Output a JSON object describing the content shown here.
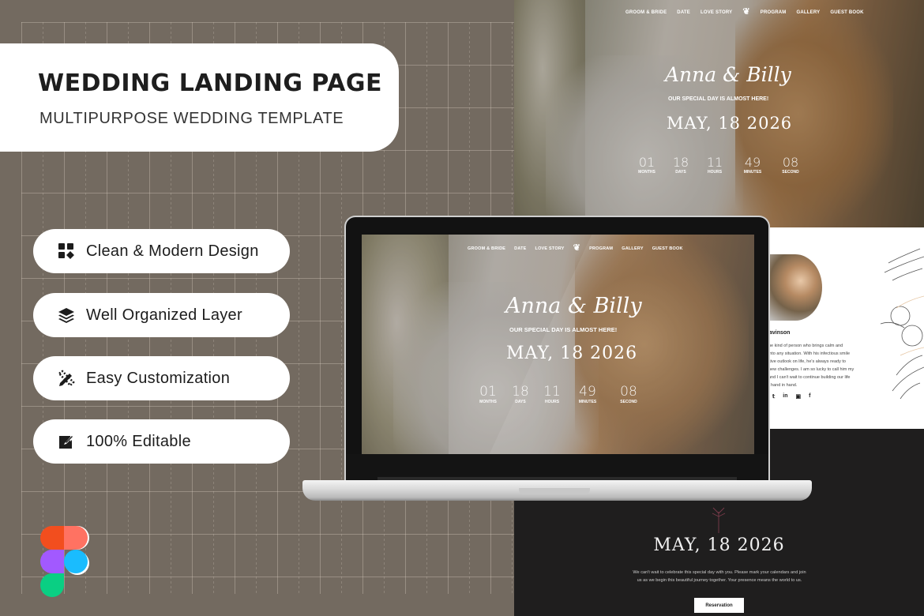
{
  "banner": {
    "title": "WEDDING LANDING PAGE",
    "subtitle": "MULTIPURPOSE WEDDING TEMPLATE"
  },
  "features": [
    {
      "icon": "widgets-icon",
      "label": "Clean & Modern Design"
    },
    {
      "icon": "layers-icon",
      "label": "Well Organized Layer"
    },
    {
      "icon": "design-tools-icon",
      "label": "Easy Customization"
    },
    {
      "icon": "edit-icon",
      "label": "100% Editable"
    }
  ],
  "tool_logo": "figma-logo",
  "site": {
    "nav": {
      "left": [
        "GROOM & BRIDE",
        "DATE",
        "LOVE STORY"
      ],
      "logo_icon": "tulip-icon",
      "right": [
        "PROGRAM",
        "GALLERY",
        "GUEST BOOK"
      ]
    },
    "hero": {
      "couple": "Anna & Billy",
      "tagline": "OUR SPECIAL DAY IS ALMOST HERE!",
      "date": "MAY, 18 2026",
      "countdown": [
        {
          "value": "01",
          "unit": "MONTHS"
        },
        {
          "value": "18",
          "unit": "DAYS"
        },
        {
          "value": "11",
          "unit": "HOURS"
        },
        {
          "value": "49",
          "unit": "MINUTES"
        },
        {
          "value": "08",
          "unit": "SECOND"
        }
      ]
    },
    "about": {
      "name_partial": "avinson",
      "bio_lines": [
        "he kind of person who brings calm and",
        "into any situation. With his infectious smile",
        "itive outlook on life, he's always ready to",
        "new challenges. I am so lucky to call him my",
        " and I can't wait to continue building our life",
        ", hand in hand."
      ],
      "socials": [
        "twitter-icon",
        "linkedin-icon",
        "youtube-icon",
        "facebook-icon"
      ]
    },
    "save_the_date": {
      "date": "MAY, 18 2026",
      "text": "We can't wait to celebrate this special day with you. Please mark your calendars and join us as we begin this beautiful journey together. Your presence means the world to us.",
      "button": "Reservation"
    }
  }
}
